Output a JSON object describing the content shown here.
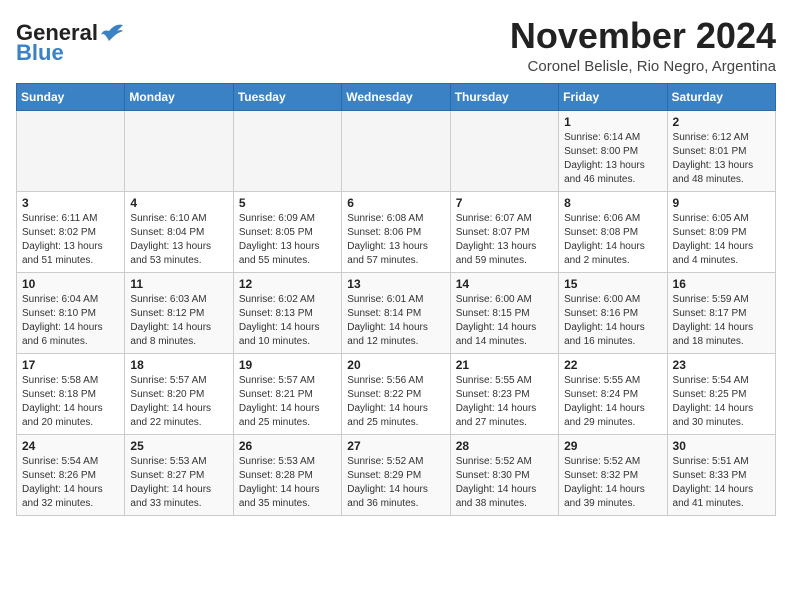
{
  "header": {
    "logo_general": "General",
    "logo_blue": "Blue",
    "month_year": "November 2024",
    "location": "Coronel Belisle, Rio Negro, Argentina"
  },
  "days_of_week": [
    "Sunday",
    "Monday",
    "Tuesday",
    "Wednesday",
    "Thursday",
    "Friday",
    "Saturday"
  ],
  "weeks": [
    [
      {
        "day": "",
        "info": ""
      },
      {
        "day": "",
        "info": ""
      },
      {
        "day": "",
        "info": ""
      },
      {
        "day": "",
        "info": ""
      },
      {
        "day": "",
        "info": ""
      },
      {
        "day": "1",
        "info": "Sunrise: 6:14 AM\nSunset: 8:00 PM\nDaylight: 13 hours and 46 minutes."
      },
      {
        "day": "2",
        "info": "Sunrise: 6:12 AM\nSunset: 8:01 PM\nDaylight: 13 hours and 48 minutes."
      }
    ],
    [
      {
        "day": "3",
        "info": "Sunrise: 6:11 AM\nSunset: 8:02 PM\nDaylight: 13 hours and 51 minutes."
      },
      {
        "day": "4",
        "info": "Sunrise: 6:10 AM\nSunset: 8:04 PM\nDaylight: 13 hours and 53 minutes."
      },
      {
        "day": "5",
        "info": "Sunrise: 6:09 AM\nSunset: 8:05 PM\nDaylight: 13 hours and 55 minutes."
      },
      {
        "day": "6",
        "info": "Sunrise: 6:08 AM\nSunset: 8:06 PM\nDaylight: 13 hours and 57 minutes."
      },
      {
        "day": "7",
        "info": "Sunrise: 6:07 AM\nSunset: 8:07 PM\nDaylight: 13 hours and 59 minutes."
      },
      {
        "day": "8",
        "info": "Sunrise: 6:06 AM\nSunset: 8:08 PM\nDaylight: 14 hours and 2 minutes."
      },
      {
        "day": "9",
        "info": "Sunrise: 6:05 AM\nSunset: 8:09 PM\nDaylight: 14 hours and 4 minutes."
      }
    ],
    [
      {
        "day": "10",
        "info": "Sunrise: 6:04 AM\nSunset: 8:10 PM\nDaylight: 14 hours and 6 minutes."
      },
      {
        "day": "11",
        "info": "Sunrise: 6:03 AM\nSunset: 8:12 PM\nDaylight: 14 hours and 8 minutes."
      },
      {
        "day": "12",
        "info": "Sunrise: 6:02 AM\nSunset: 8:13 PM\nDaylight: 14 hours and 10 minutes."
      },
      {
        "day": "13",
        "info": "Sunrise: 6:01 AM\nSunset: 8:14 PM\nDaylight: 14 hours and 12 minutes."
      },
      {
        "day": "14",
        "info": "Sunrise: 6:00 AM\nSunset: 8:15 PM\nDaylight: 14 hours and 14 minutes."
      },
      {
        "day": "15",
        "info": "Sunrise: 6:00 AM\nSunset: 8:16 PM\nDaylight: 14 hours and 16 minutes."
      },
      {
        "day": "16",
        "info": "Sunrise: 5:59 AM\nSunset: 8:17 PM\nDaylight: 14 hours and 18 minutes."
      }
    ],
    [
      {
        "day": "17",
        "info": "Sunrise: 5:58 AM\nSunset: 8:18 PM\nDaylight: 14 hours and 20 minutes."
      },
      {
        "day": "18",
        "info": "Sunrise: 5:57 AM\nSunset: 8:20 PM\nDaylight: 14 hours and 22 minutes."
      },
      {
        "day": "19",
        "info": "Sunrise: 5:57 AM\nSunset: 8:21 PM\nDaylight: 14 hours and 25 minutes."
      },
      {
        "day": "20",
        "info": "Sunrise: 5:56 AM\nSunset: 8:22 PM\nDaylight: 14 hours and 25 minutes."
      },
      {
        "day": "21",
        "info": "Sunrise: 5:55 AM\nSunset: 8:23 PM\nDaylight: 14 hours and 27 minutes."
      },
      {
        "day": "22",
        "info": "Sunrise: 5:55 AM\nSunset: 8:24 PM\nDaylight: 14 hours and 29 minutes."
      },
      {
        "day": "23",
        "info": "Sunrise: 5:54 AM\nSunset: 8:25 PM\nDaylight: 14 hours and 30 minutes."
      }
    ],
    [
      {
        "day": "24",
        "info": "Sunrise: 5:54 AM\nSunset: 8:26 PM\nDaylight: 14 hours and 32 minutes."
      },
      {
        "day": "25",
        "info": "Sunrise: 5:53 AM\nSunset: 8:27 PM\nDaylight: 14 hours and 33 minutes."
      },
      {
        "day": "26",
        "info": "Sunrise: 5:53 AM\nSunset: 8:28 PM\nDaylight: 14 hours and 35 minutes."
      },
      {
        "day": "27",
        "info": "Sunrise: 5:52 AM\nSunset: 8:29 PM\nDaylight: 14 hours and 36 minutes."
      },
      {
        "day": "28",
        "info": "Sunrise: 5:52 AM\nSunset: 8:30 PM\nDaylight: 14 hours and 38 minutes."
      },
      {
        "day": "29",
        "info": "Sunrise: 5:52 AM\nSunset: 8:32 PM\nDaylight: 14 hours and 39 minutes."
      },
      {
        "day": "30",
        "info": "Sunrise: 5:51 AM\nSunset: 8:33 PM\nDaylight: 14 hours and 41 minutes."
      }
    ]
  ]
}
